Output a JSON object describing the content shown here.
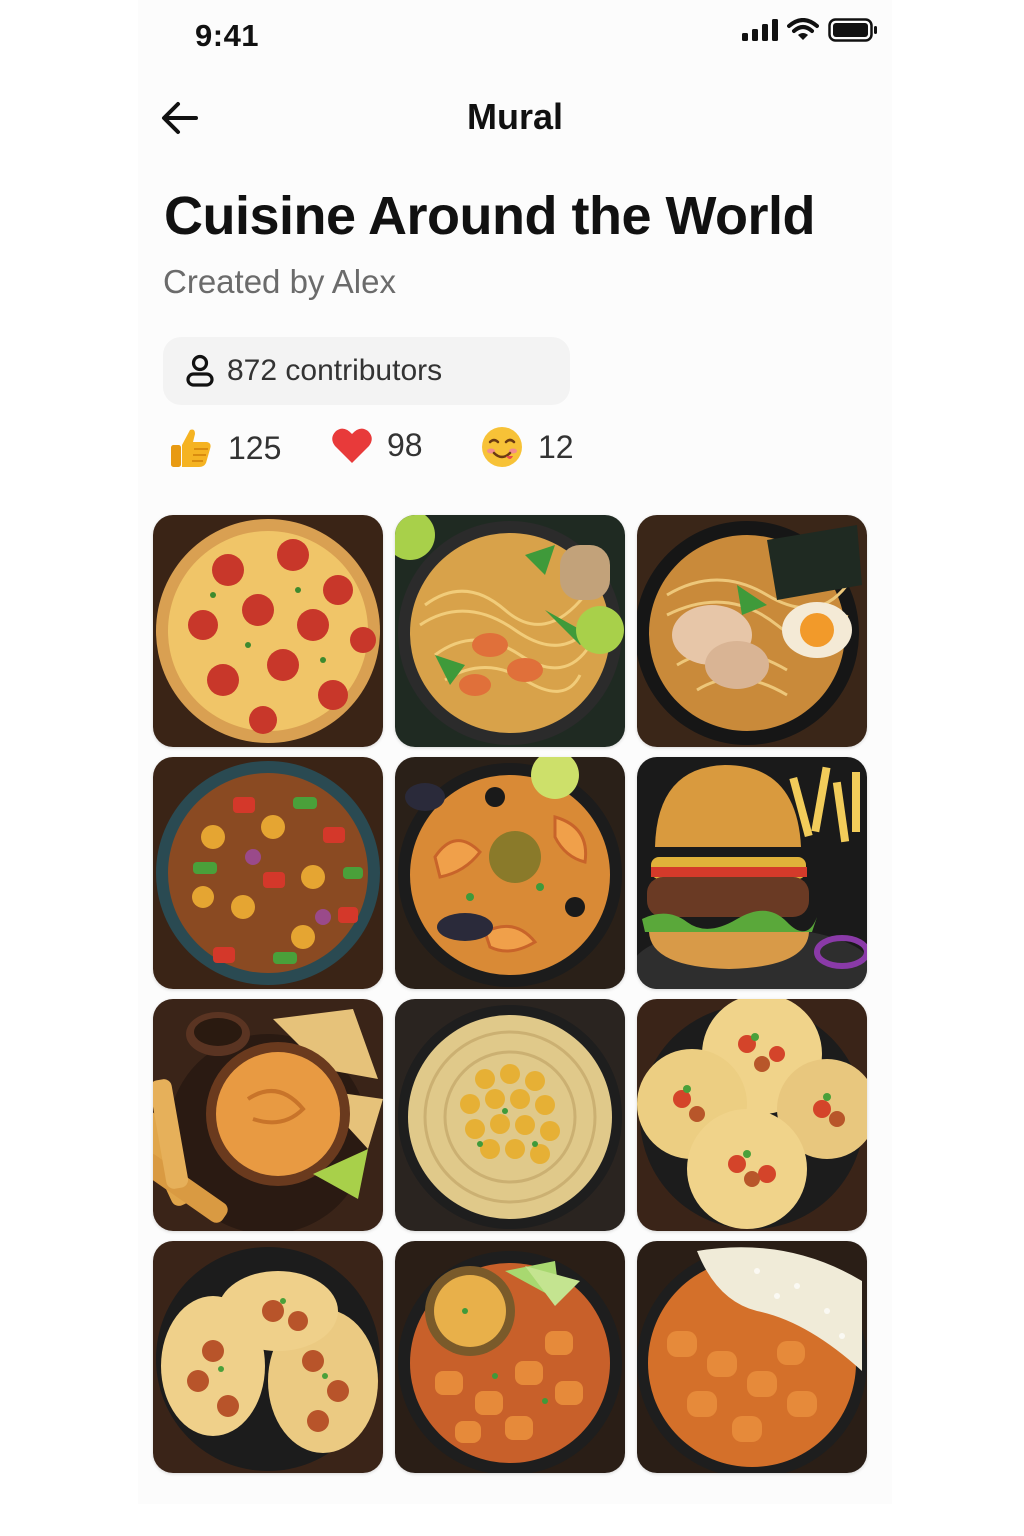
{
  "status_bar": {
    "time": "9:41"
  },
  "nav": {
    "title": "Mural",
    "back_icon": "arrow-left-icon"
  },
  "mural": {
    "title": "Cuisine Around the World",
    "creator": "Created by Alex",
    "contributors": "872 contributors"
  },
  "reactions": [
    {
      "icon": "thumbs-up-icon",
      "count": "125"
    },
    {
      "icon": "heart-icon",
      "count": "98"
    },
    {
      "icon": "yum-face-icon",
      "count": "12"
    }
  ],
  "colors": {
    "accent_yellow": "#F5B322",
    "heart_red": "#E83A3A",
    "pill_bg": "#F3F3F3"
  },
  "gallery": [
    {
      "dish": "pizza"
    },
    {
      "dish": "noodles"
    },
    {
      "dish": "ramen"
    },
    {
      "dish": "vegetable-stir-fry"
    },
    {
      "dish": "seafood-curry"
    },
    {
      "dish": "burger"
    },
    {
      "dish": "dip-and-chips"
    },
    {
      "dish": "hummus"
    },
    {
      "dish": "tacos"
    },
    {
      "dish": "chicken-tacos"
    },
    {
      "dish": "chicken-curry"
    },
    {
      "dish": "curry-with-rice"
    }
  ]
}
